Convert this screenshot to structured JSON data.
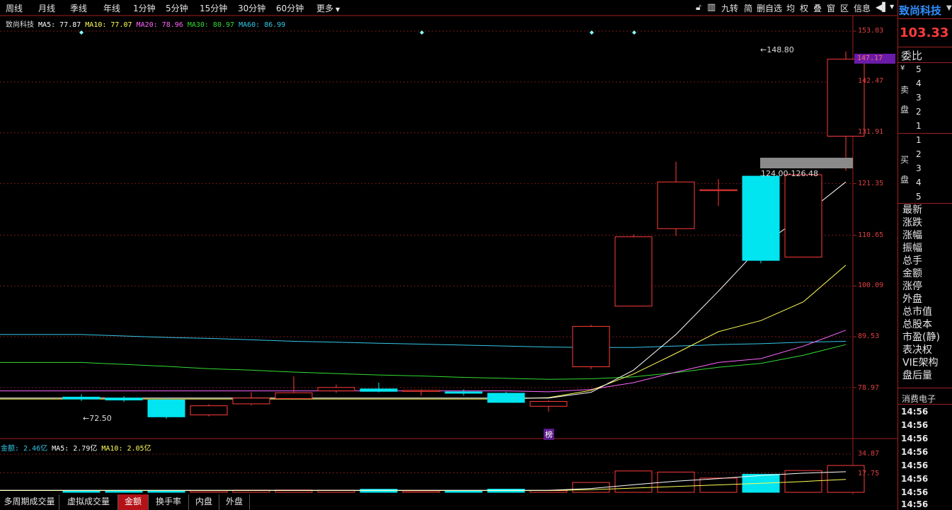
{
  "periods": [
    "周线",
    "月线",
    "季线",
    "年线",
    "1分钟",
    "5分钟",
    "15分钟",
    "30分钟",
    "60分钟",
    "更多"
  ],
  "tools": [
    "九转",
    "简",
    "删自选",
    "均",
    "权",
    "叠",
    "窗",
    "区",
    "信息"
  ],
  "stock": {
    "name": "致尚科技",
    "price": "103.33"
  },
  "ma_legend": {
    "name": "致尚科技",
    "ma5": "MA5: 77.87",
    "ma10": "MA10: 77.07",
    "ma20": "MA20: 78.96",
    "ma30": "MA30: 80.97",
    "ma60": "MA60: 86.99"
  },
  "vol_legend": {
    "amount": "金额: 2.46亿",
    "ma5": "MA5: 2.79亿",
    "ma10": "MA10: 2.05亿"
  },
  "price_axis": [
    "153.03",
    "142.47",
    "131.91",
    "121.35",
    "110.65",
    "100.09",
    "89.53",
    "78.97"
  ],
  "vol_axis": [
    "34.87",
    "17.75"
  ],
  "current_price_label": "147.17",
  "annotations": {
    "high": "148.80",
    "low": "72.50",
    "range": "124.00-126.48",
    "bang": "榜"
  },
  "tabs": [
    "多周期成交量",
    "虚拟成交量",
    "金额",
    "换手率",
    "内盘",
    "外盘"
  ],
  "active_tab": "金额",
  "right_panel": {
    "weibi": "委比",
    "sell_label": [
      "卖",
      "盘"
    ],
    "sell_symbol": "¥",
    "sell_levels": [
      "5",
      "4",
      "3",
      "2",
      "1"
    ],
    "buy_label": [
      "买",
      "盘"
    ],
    "buy_levels": [
      "1",
      "2",
      "3",
      "4",
      "5"
    ],
    "fields": [
      "最新",
      "涨跌",
      "涨幅",
      "振幅",
      "总手",
      "金额",
      "涨停",
      "外盘",
      "总市值",
      "总股本",
      "市盈(静)",
      "表决权",
      "VIE架构",
      "盘后量"
    ],
    "industry": "消费电子",
    "times": [
      "14:56",
      "14:56",
      "14:56",
      "14:56",
      "14:56",
      "14:56",
      "14:56",
      "14:56"
    ]
  },
  "colors": {
    "up": "#ff3b3b",
    "down": "#00e5f0",
    "ma5": "#ffffff",
    "ma10": "#ffff55",
    "ma20": "#ff66ff",
    "ma30": "#33dd33",
    "ma60": "#33c8e8",
    "active_tab": "#b31217"
  },
  "icons": [
    "lock-icon",
    "flag-icon",
    "chevron-down-icon"
  ],
  "chart_data": {
    "type": "candlestick",
    "price_range": [
      72.5,
      153.03
    ],
    "candles": [
      {
        "o": 77.0,
        "h": 77.6,
        "l": 76.2,
        "c": 76.6,
        "dir": "down"
      },
      {
        "o": 76.8,
        "h": 77.2,
        "l": 76.0,
        "c": 76.4,
        "dir": "down"
      },
      {
        "o": 76.4,
        "h": 76.8,
        "l": 72.5,
        "c": 72.9,
        "dir": "down"
      },
      {
        "o": 73.3,
        "h": 75.5,
        "l": 73.0,
        "c": 75.2,
        "dir": "up"
      },
      {
        "o": 75.6,
        "h": 78.0,
        "l": 75.3,
        "c": 76.8,
        "dir": "up"
      },
      {
        "o": 76.7,
        "h": 81.3,
        "l": 76.4,
        "c": 77.9,
        "dir": "up"
      },
      {
        "o": 78.3,
        "h": 79.6,
        "l": 77.9,
        "c": 79.0,
        "dir": "up"
      },
      {
        "o": 78.7,
        "h": 80.0,
        "l": 78.0,
        "c": 78.2,
        "dir": "down"
      },
      {
        "o": 78.2,
        "h": 78.6,
        "l": 77.3,
        "c": 78.4,
        "dir": "up"
      },
      {
        "o": 78.1,
        "h": 78.6,
        "l": 77.3,
        "c": 77.8,
        "dir": "down"
      },
      {
        "o": 77.8,
        "h": 78.1,
        "l": 76.0,
        "c": 75.9,
        "dir": "down"
      },
      {
        "o": 75.1,
        "h": 76.3,
        "l": 74.0,
        "c": 76.1,
        "dir": "up"
      },
      {
        "o": 83.3,
        "h": 92.0,
        "l": 82.8,
        "c": 91.7,
        "dir": "up"
      },
      {
        "o": 95.9,
        "h": 110.8,
        "l": 95.8,
        "c": 110.3,
        "dir": "up"
      },
      {
        "o": 112.0,
        "h": 125.9,
        "l": 110.5,
        "c": 121.7,
        "dir": "up"
      },
      {
        "o": 120.1,
        "h": 122.3,
        "l": 116.7,
        "c": 120.1,
        "dir": "up"
      },
      {
        "o": 122.9,
        "h": 123.2,
        "l": 104.8,
        "c": 105.4,
        "dir": "down"
      },
      {
        "o": 106.1,
        "h": 123.3,
        "l": 106.1,
        "c": 123.2,
        "dir": "up"
      },
      {
        "o": 131.2,
        "h": 148.8,
        "l": 124.0,
        "c": 147.2,
        "dir": "up"
      }
    ],
    "ma5": [
      null,
      null,
      null,
      null,
      null,
      null,
      null,
      null,
      null,
      null,
      null,
      76.8,
      78.0,
      82.6,
      90.0,
      99.0,
      108.4,
      114.7,
      121.7
    ],
    "ma10": [
      null,
      null,
      null,
      null,
      null,
      null,
      null,
      null,
      null,
      null,
      76.6,
      76.9,
      78.4,
      81.8,
      86.1,
      90.6,
      92.9,
      96.8,
      104.4
    ],
    "ma20": [
      null,
      null,
      null,
      null,
      null,
      null,
      null,
      null,
      null,
      null,
      78.3,
      78.1,
      78.6,
      80.0,
      82.2,
      84.2,
      85.0,
      87.6,
      90.9
    ],
    "ma30": [
      84.2,
      83.8,
      83.4,
      82.9,
      82.6,
      82.2,
      81.9,
      81.6,
      81.4,
      81.1,
      80.9,
      80.7,
      80.8,
      81.2,
      82.1,
      83.2,
      84.0,
      85.7,
      87.9
    ],
    "ma60": [
      90.0,
      89.7,
      89.4,
      89.2,
      88.9,
      88.6,
      88.4,
      88.2,
      88.0,
      87.8,
      87.6,
      87.4,
      87.3,
      87.3,
      87.6,
      87.9,
      88.1,
      88.4,
      88.6
    ],
    "amount_range": [
      0,
      34.87
    ],
    "amounts": [
      1.2,
      1.1,
      1.0,
      1.4,
      2.0,
      2.1,
      1.9,
      2.8,
      1.3,
      1.2,
      2.9,
      1.6,
      9.0,
      19.5,
      18.5,
      13.0,
      16.5,
      19.9,
      24.5
    ],
    "amount_ma5": [
      null,
      null,
      null,
      null,
      null,
      null,
      null,
      null,
      null,
      null,
      null,
      1.9,
      3.5,
      6.9,
      10.2,
      12.5,
      15.3,
      17.5,
      18.8
    ],
    "amount_ma10": [
      null,
      null,
      null,
      null,
      null,
      null,
      null,
      null,
      null,
      null,
      null,
      1.6,
      2.4,
      3.9,
      5.3,
      6.8,
      8.2,
      9.9,
      11.8
    ]
  }
}
